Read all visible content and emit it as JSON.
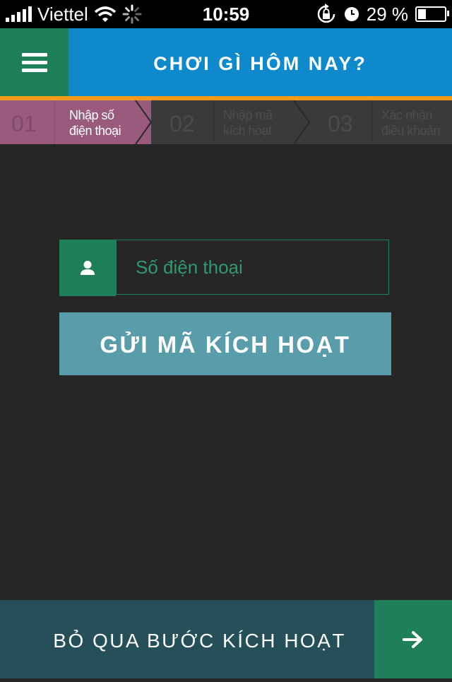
{
  "status_bar": {
    "carrier": "Viettel",
    "time": "10:59",
    "battery": "29 %",
    "signal_icon": "signal-bars-icon",
    "wifi_icon": "wifi-icon",
    "loading_icon": "activity-spinner-icon",
    "rotation_lock_icon": "rotation-lock-icon",
    "alarm_icon": "alarm-icon",
    "battery_icon": "battery-icon"
  },
  "header": {
    "title": "CHƠI GÌ HÔM NAY?",
    "menu_icon": "hamburger-menu-icon",
    "bg_color": "#0e89cc",
    "menu_bg_color": "#1f7f58",
    "accent_color": "#f39a1b"
  },
  "steps": [
    {
      "number": "01",
      "label_line1": "Nhập số",
      "label_line2": "điện thoại",
      "active": true
    },
    {
      "number": "02",
      "label_line1": "Nhập mã",
      "label_line2": "kích hoạt",
      "active": false
    },
    {
      "number": "03",
      "label_line1": "Xác nhận",
      "label_line2": "điều khoản",
      "active": false
    }
  ],
  "form": {
    "phone_icon": "user-icon",
    "phone_placeholder": "Số điện thoại",
    "phone_value": "",
    "send_button": "GỬI MÃ KÍCH HOẠT",
    "send_button_color": "#5a9daa"
  },
  "footer": {
    "skip_label": "BỎ QUA BƯỚC KÍCH HOẠT",
    "arrow_icon": "arrow-right-icon",
    "bg_color": "#25505a"
  }
}
